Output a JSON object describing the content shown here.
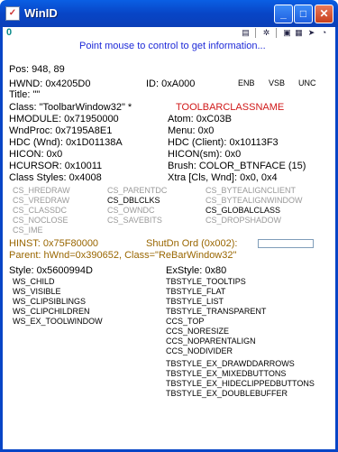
{
  "window": {
    "title": "WinID"
  },
  "toolbar": {
    "left_label": "0"
  },
  "hint": "Point mouse to control to get information...",
  "pos": "Pos: 948, 89",
  "hwnd": "HWND: 0x4205D0",
  "id": "ID: 0xA000",
  "flags": [
    "ENB",
    "VSB",
    "UNC"
  ],
  "title_line": "Title: \"\"",
  "class_line": "Class: \"ToolbarWindow32\" *",
  "class_name_const": "TOOLBARCLASSNAME",
  "hmodule": "HMODULE: 0x71950000",
  "atom": "Atom: 0xC03B",
  "wndproc": "WndProc: 0x7195A8E1",
  "menu": "Menu: 0x0",
  "hdc_wnd": "HDC (Wnd): 0x1D01138A",
  "hdc_client": "HDC (Client): 0x10113F3",
  "hicon": "HICON: 0x0",
  "hicon_sm": "HICON(sm): 0x0",
  "hcursor": "HCURSOR: 0x10011",
  "brush": "Brush: COLOR_BTNFACE (15)",
  "class_styles": "Class Styles: 0x4008",
  "xtra": "Xtra [Cls, Wnd]: 0x0, 0x4",
  "cs_col1": [
    "CS_HREDRAW",
    "CS_VREDRAW",
    "CS_CLASSDC",
    "CS_NOCLOSE",
    "CS_IME"
  ],
  "cs_col1_active": [
    false,
    false,
    false,
    false,
    false
  ],
  "cs_col2": [
    "CS_DBLCLKS",
    "CS_OWNDC",
    "CS_SAVEBITS"
  ],
  "cs_col2_active": [
    true,
    false,
    false
  ],
  "cs_col3": [
    "CS_PARENTDC",
    "CS_BYTEALIGNCLIENT",
    "CS_BYTEALIGNWINDOW",
    "CS_GLOBALCLASS",
    "CS_DROPSHADOW"
  ],
  "cs_col3_active": [
    false,
    false,
    false,
    true,
    false
  ],
  "hinst": "HINST: 0x75F80000",
  "shutdn": "ShutDn Ord (0x002):",
  "parent": "Parent: hWnd=0x390652, Class=\"ReBarWindow32\"",
  "style": "Style: 0x5600994D",
  "exstyle": "ExStyle: 0x80",
  "ws_list": [
    "WS_CHILD",
    "WS_VISIBLE",
    "WS_CLIPSIBLINGS",
    "WS_CLIPCHILDREN",
    "WS_EX_TOOLWINDOW"
  ],
  "tb_list": [
    "TBSTYLE_TOOLTIPS",
    "TBSTYLE_FLAT",
    "TBSTYLE_LIST",
    "TBSTYLE_TRANSPARENT",
    "CCS_TOP",
    "CCS_NORESIZE",
    "CCS_NOPARENTALIGN",
    "CCS_NODIVIDER"
  ],
  "tbex_list": [
    "TBSTYLE_EX_DRAWDDARROWS",
    "TBSTYLE_EX_MIXEDBUTTONS",
    "TBSTYLE_EX_HIDECLIPPEDBUTTONS",
    "TBSTYLE_EX_DOUBLEBUFFER"
  ]
}
